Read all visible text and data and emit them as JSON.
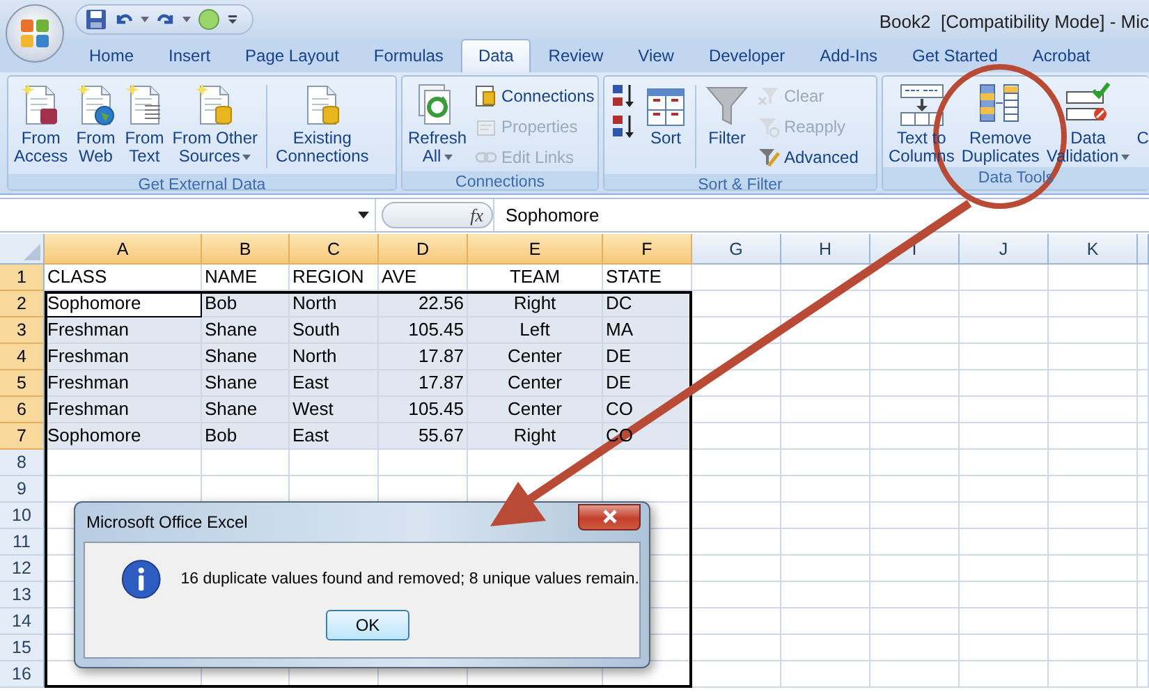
{
  "title_bar": {
    "title": "Book2  [Compatibility Mode] - Mic"
  },
  "tabs": [
    {
      "label": "Home",
      "selected": false
    },
    {
      "label": "Insert",
      "selected": false
    },
    {
      "label": "Page Layout",
      "selected": false
    },
    {
      "label": "Formulas",
      "selected": false
    },
    {
      "label": "Data",
      "selected": true
    },
    {
      "label": "Review",
      "selected": false
    },
    {
      "label": "View",
      "selected": false
    },
    {
      "label": "Developer",
      "selected": false
    },
    {
      "label": "Add-Ins",
      "selected": false
    },
    {
      "label": "Get Started",
      "selected": false
    },
    {
      "label": "Acrobat",
      "selected": false
    }
  ],
  "ribbon": {
    "groups": [
      {
        "title": "Get External Data",
        "items": [
          {
            "kind": "large",
            "lines": [
              "From",
              "Access"
            ],
            "dropdown": false
          },
          {
            "kind": "large",
            "lines": [
              "From",
              "Web"
            ],
            "dropdown": false
          },
          {
            "kind": "large",
            "lines": [
              "From",
              "Text"
            ],
            "dropdown": false
          },
          {
            "kind": "large",
            "lines": [
              "From Other",
              "Sources"
            ],
            "dropdown": true
          },
          {
            "kind": "separator"
          },
          {
            "kind": "large",
            "lines": [
              "Existing",
              "Connections"
            ],
            "dropdown": false
          }
        ]
      },
      {
        "title": "Connections",
        "items": [
          {
            "kind": "large",
            "lines": [
              "Refresh",
              "All"
            ],
            "dropdown": true
          },
          {
            "kind": "stack",
            "items": [
              {
                "label": "Connections",
                "disabled": false
              },
              {
                "label": "Properties",
                "disabled": true
              },
              {
                "label": "Edit Links",
                "disabled": true
              }
            ]
          }
        ]
      },
      {
        "title": "Sort & Filter",
        "items": [
          {
            "kind": "stack",
            "items": [
              {
                "disabled": false
              },
              {
                "disabled": false
              }
            ]
          },
          {
            "kind": "large",
            "lines": [
              "Sort"
            ],
            "dropdown": false
          },
          {
            "kind": "separator"
          },
          {
            "kind": "large",
            "lines": [
              "Filter"
            ],
            "dropdown": false
          },
          {
            "kind": "stack",
            "items": [
              {
                "label": "Clear",
                "disabled": true
              },
              {
                "label": "Reapply",
                "disabled": true
              },
              {
                "label": "Advanced",
                "disabled": false
              }
            ]
          }
        ]
      },
      {
        "title": "Data Tools",
        "items": [
          {
            "kind": "large",
            "lines": [
              "Text to",
              "Columns"
            ],
            "dropdown": false
          },
          {
            "kind": "large",
            "lines": [
              "Remove",
              "Duplicates"
            ],
            "dropdown": false
          },
          {
            "kind": "large",
            "lines": [
              "Data",
              "Validation"
            ],
            "dropdown": true
          },
          {
            "kind": "large",
            "lines": [
              "C"
            ],
            "dropdown": false
          }
        ]
      }
    ]
  },
  "formula_bar": {
    "function_label": "fx",
    "formula": "Sophomore"
  },
  "sheet": {
    "columns": [
      {
        "label": "A",
        "selected": true
      },
      {
        "label": "B",
        "selected": true
      },
      {
        "label": "C",
        "selected": true
      },
      {
        "label": "D",
        "selected": true
      },
      {
        "label": "E",
        "selected": true
      },
      {
        "label": "F",
        "selected": true
      },
      {
        "label": "G",
        "selected": false
      },
      {
        "label": "H",
        "selected": false
      },
      {
        "label": "I",
        "selected": false
      },
      {
        "label": "J",
        "selected": false
      },
      {
        "label": "K",
        "selected": false
      }
    ],
    "rows": [
      {
        "number": "1",
        "kind": "header",
        "selected": true,
        "active": false,
        "cells": [
          "CLASS",
          "NAME",
          "REGION",
          "AVE",
          "TEAM",
          "STATE"
        ]
      },
      {
        "number": "2",
        "kind": "data",
        "selected": true,
        "active": true,
        "cells": [
          "Sophomore",
          "Bob",
          "North",
          "22.56",
          "Right",
          "DC"
        ]
      },
      {
        "number": "3",
        "kind": "data",
        "selected": true,
        "active": false,
        "cells": [
          "Freshman",
          "Shane",
          "South",
          "105.45",
          "Left",
          "MA"
        ]
      },
      {
        "number": "4",
        "kind": "data",
        "selected": true,
        "active": false,
        "cells": [
          "Freshman",
          "Shane",
          "North",
          "17.87",
          "Center",
          "DE"
        ]
      },
      {
        "number": "5",
        "kind": "data",
        "selected": true,
        "active": false,
        "cells": [
          "Freshman",
          "Shane",
          "East",
          "17.87",
          "Center",
          "DE"
        ]
      },
      {
        "number": "6",
        "kind": "data",
        "selected": true,
        "active": false,
        "cells": [
          "Freshman",
          "Shane",
          "West",
          "105.45",
          "Center",
          "CO"
        ]
      },
      {
        "number": "7",
        "kind": "data",
        "selected": true,
        "active": false,
        "cells": [
          "Sophomore",
          "Bob",
          "East",
          "55.67",
          "Right",
          "CO"
        ]
      },
      {
        "number": "8",
        "kind": "data",
        "selected": false,
        "active": false,
        "cells": []
      },
      {
        "number": "9",
        "kind": "data",
        "selected": false,
        "active": false,
        "cells": []
      },
      {
        "number": "10",
        "kind": "data",
        "selected": false,
        "active": false,
        "cells": []
      },
      {
        "number": "11",
        "kind": "data",
        "selected": false,
        "active": false,
        "cells": []
      },
      {
        "number": "12",
        "kind": "data",
        "selected": false,
        "active": false,
        "cells": []
      },
      {
        "number": "13",
        "kind": "data",
        "selected": false,
        "active": false,
        "cells": []
      },
      {
        "number": "14",
        "kind": "data",
        "selected": false,
        "active": false,
        "cells": []
      },
      {
        "number": "15",
        "kind": "data",
        "selected": false,
        "active": false,
        "cells": []
      },
      {
        "number": "16",
        "kind": "data",
        "selected": false,
        "active": false,
        "cells": []
      }
    ]
  },
  "dialog": {
    "title": "Microsoft Office Excel",
    "message": "16 duplicate values found and removed; 8 unique values remain.",
    "buttons": [
      "OK"
    ]
  }
}
